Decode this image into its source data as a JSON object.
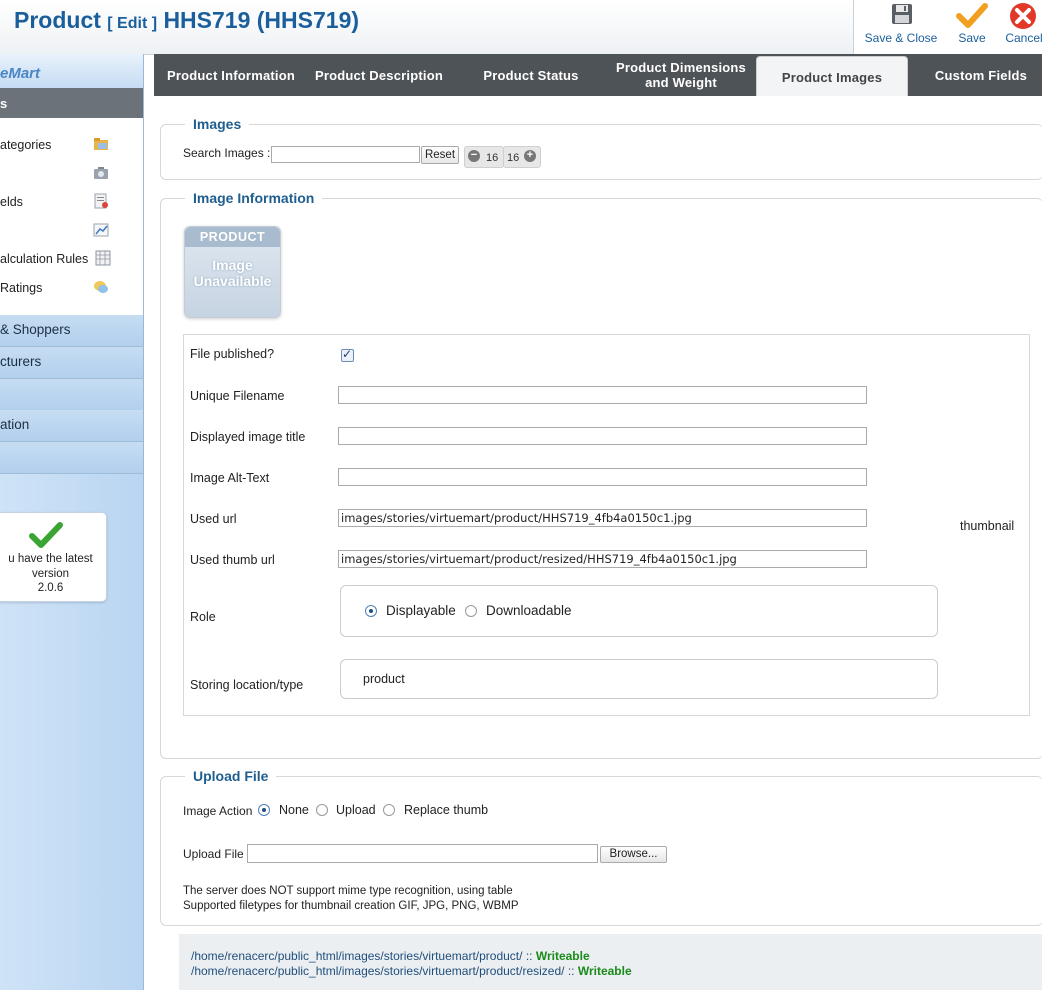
{
  "header": {
    "title_main": "Product",
    "title_edit": "[ Edit ]",
    "title_product": "HHS719 (HHS719)"
  },
  "toolbar": {
    "save_close_label": "Save & Close",
    "save_label": "Save",
    "cancel_label": "Cancel"
  },
  "sidebar": {
    "logo": "eMart",
    "section_label": "s",
    "sub_items": [
      {
        "label": "ategories",
        "icon": "folder-icon"
      },
      {
        "label": "",
        "icon": "camera-icon"
      },
      {
        "label": "elds",
        "icon": "fields-icon"
      },
      {
        "label": "",
        "icon": "chart-icon"
      },
      {
        "label": "alculation Rules",
        "icon": "calculator-icon"
      },
      {
        "label": "Ratings",
        "icon": "comment-icon"
      }
    ],
    "main_items": [
      {
        "label": "& Shoppers"
      },
      {
        "label": "cturers"
      },
      {
        "label": ""
      },
      {
        "label": "ation"
      },
      {
        "label": ""
      }
    ],
    "version": {
      "line1": "u have the latest",
      "line2": "version",
      "line3": "2.0.6"
    }
  },
  "tabs": [
    {
      "label": "Product Information",
      "active": false
    },
    {
      "label": "Product Description",
      "active": false
    },
    {
      "label": "Product Status",
      "active": false
    },
    {
      "label": "Product Dimensions and Weight",
      "active": false
    },
    {
      "label": "Product Images",
      "active": true
    },
    {
      "label": "Custom Fields",
      "active": false
    }
  ],
  "images_section": {
    "legend": "Images",
    "search_label": "Search Images :",
    "search_value": "",
    "reset_label": "Reset",
    "pager_prev": "16",
    "pager_next": "16"
  },
  "image_info": {
    "legend": "Image Information",
    "placeholder_top": "PRODUCT",
    "placeholder_l1": "Image",
    "placeholder_l2": "Unavailable",
    "file_published_label": "File published?",
    "file_published": true,
    "unique_filename_label": "Unique Filename",
    "unique_filename": "",
    "displayed_title_label": "Displayed image title",
    "displayed_title": "",
    "alt_text_label": "Image Alt-Text",
    "alt_text": "",
    "used_url_label": "Used url",
    "used_url": "images/stories/virtuemart/product/HHS719_4fb4a0150c1.jpg",
    "used_thumb_url_label": "Used thumb url",
    "used_thumb_url": "images/stories/virtuemart/product/resized/HHS719_4fb4a0150c1.jpg",
    "thumbnail_label": "thumbnail",
    "role_label": "Role",
    "role_options": [
      "Displayable",
      "Downloadable"
    ],
    "role_selected": "Displayable",
    "storing_label": "Storing location/type",
    "storing_value": "product"
  },
  "upload": {
    "legend": "Upload File",
    "action_label": "Image Action",
    "action_options": [
      "None",
      "Upload",
      "Replace thumb"
    ],
    "action_selected": "None",
    "file_label": "Upload File",
    "browse_label": "Browse...",
    "note1": "The server does NOT support mime type recognition, using table",
    "note2": "Supported filetypes for thumbnail creation GIF, JPG, PNG, WBMP"
  },
  "paths": [
    {
      "path": "/home/renacerc/public_html/images/stories/virtuemart/product/",
      "sep": " :: ",
      "status": "Writeable"
    },
    {
      "path": "/home/renacerc/public_html/images/stories/virtuemart/product/resized/",
      "sep": " :: ",
      "status": "Writeable"
    }
  ],
  "colors": {
    "accent": "#1a5f9c",
    "tab_bar": "#4e5357",
    "writeable": "#1a8a1a"
  }
}
